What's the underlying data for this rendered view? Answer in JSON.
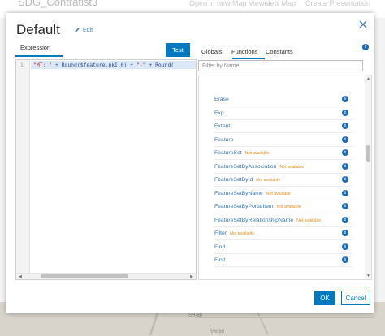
{
  "background": {
    "app_title": "SDG_Contratist3",
    "links": [
      "Open in new Map Viewer",
      "New Map",
      "Create Presentation"
    ],
    "map_labels": [
      "SH-88",
      "SW 80"
    ]
  },
  "modal": {
    "title": "Default",
    "edit_label": "Edit",
    "expression_tab": "Expression",
    "test_button": "Test",
    "line_number": "1",
    "code": {
      "s1": "\"MT: \"",
      "p1": " + Round($feature.pkI,0) + ",
      "s2": "\"-\"",
      "p2": " + Round("
    },
    "tabs": [
      "Globals",
      "Functions",
      "Constants"
    ],
    "active_tab": "Functions",
    "filter_placeholder": "Filter by Name",
    "not_available": "Not available",
    "functions": [
      {
        "name": "Erase",
        "available": true
      },
      {
        "name": "Exp",
        "available": true
      },
      {
        "name": "Extent",
        "available": true
      },
      {
        "name": "Feature",
        "available": true
      },
      {
        "name": "FeatureSet",
        "available": false
      },
      {
        "name": "FeatureSetByAssociation",
        "available": false
      },
      {
        "name": "FeatureSetById",
        "available": false
      },
      {
        "name": "FeatureSetByName",
        "available": false
      },
      {
        "name": "FeatureSetByPortalItem",
        "available": false
      },
      {
        "name": "FeatureSetByRelationshipName",
        "available": false
      },
      {
        "name": "Filter",
        "available": false
      },
      {
        "name": "Find",
        "available": true
      },
      {
        "name": "First",
        "available": true
      }
    ],
    "ok_button": "OK",
    "cancel_button": "Cancel"
  },
  "colors": {
    "accent": "#0079c1",
    "link": "#3576b5",
    "not_available": "#e58a17",
    "info_icon": "#1a6bb5"
  },
  "icons": {
    "close": "close-icon",
    "edit": "pencil-icon",
    "info": "info-icon"
  }
}
